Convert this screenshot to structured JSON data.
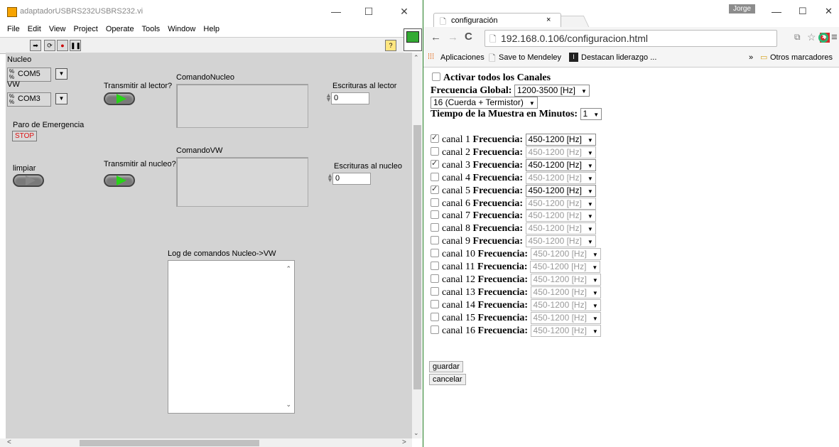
{
  "labview": {
    "title": "adaptadorUSBRS232USBRS232.vi",
    "menu": [
      "File",
      "Edit",
      "View",
      "Project",
      "Operate",
      "Tools",
      "Window",
      "Help"
    ],
    "nucleo_label": "Nucleo",
    "nucleo_port": "COM5",
    "vw_label": "VW",
    "vw_port": "COM3",
    "transmit_reader_label": "Transmitir al lector?",
    "comando_nucleo_label": "ComandoNucleo",
    "escrituras_lector_label": "Escrituras al lector",
    "escrituras_lector_value": "0",
    "paro_label": "Paro de Emergencia",
    "stop_label": "STOP",
    "limpiar_label": "limpiar",
    "transmit_nucleo_label": "Transmitir al nucleo?",
    "comando_vw_label": "ComandoVW",
    "escrituras_nucleo_label": "Escrituras al nucleo",
    "escrituras_nucleo_value": "0",
    "log_label": "Log de comandos Nucleo->VW"
  },
  "chrome": {
    "tab_title": "configuración",
    "user": "Jorge",
    "url": "192.168.0.106/configuracion.html",
    "bookmarks": [
      "Aplicaciones",
      "Save to Mendeley",
      "Destacan liderazgo ..."
    ],
    "bookmarks_more": "»",
    "other_bookmarks": "Otros marcadores"
  },
  "form": {
    "activar_label": "Activar todos los Canales",
    "frecuencia_global_label": "Frecuencia Global:",
    "frecuencia_global_value": "1200-3500 [Hz]",
    "tipo_value": "16 (Cuerda + Termistor)",
    "tiempo_label": "Tiempo de la Muestra en Minutos:",
    "tiempo_value": "1",
    "freq_label": "Frecuencia:",
    "channels": [
      {
        "name": "canal 1",
        "checked": true,
        "freq": "450-1200 [Hz]"
      },
      {
        "name": "canal 2",
        "checked": false,
        "freq": "450-1200 [Hz]"
      },
      {
        "name": "canal 3",
        "checked": true,
        "freq": "450-1200 [Hz]"
      },
      {
        "name": "canal 4",
        "checked": false,
        "freq": "450-1200 [Hz]"
      },
      {
        "name": "canal 5",
        "checked": true,
        "freq": "450-1200 [Hz]"
      },
      {
        "name": "canal 6",
        "checked": false,
        "freq": "450-1200 [Hz]"
      },
      {
        "name": "canal 7",
        "checked": false,
        "freq": "450-1200 [Hz]"
      },
      {
        "name": "canal 8",
        "checked": false,
        "freq": "450-1200 [Hz]"
      },
      {
        "name": "canal 9",
        "checked": false,
        "freq": "450-1200 [Hz]"
      },
      {
        "name": "canal 10",
        "checked": false,
        "freq": "450-1200 [Hz]"
      },
      {
        "name": "canal 11",
        "checked": false,
        "freq": "450-1200 [Hz]"
      },
      {
        "name": "canal 12",
        "checked": false,
        "freq": "450-1200 [Hz]"
      },
      {
        "name": "canal 13",
        "checked": false,
        "freq": "450-1200 [Hz]"
      },
      {
        "name": "canal 14",
        "checked": false,
        "freq": "450-1200 [Hz]"
      },
      {
        "name": "canal 15",
        "checked": false,
        "freq": "450-1200 [Hz]"
      },
      {
        "name": "canal 16",
        "checked": false,
        "freq": "450-1200 [Hz]"
      }
    ],
    "guardar_label": "guardar",
    "cancelar_label": "cancelar"
  }
}
